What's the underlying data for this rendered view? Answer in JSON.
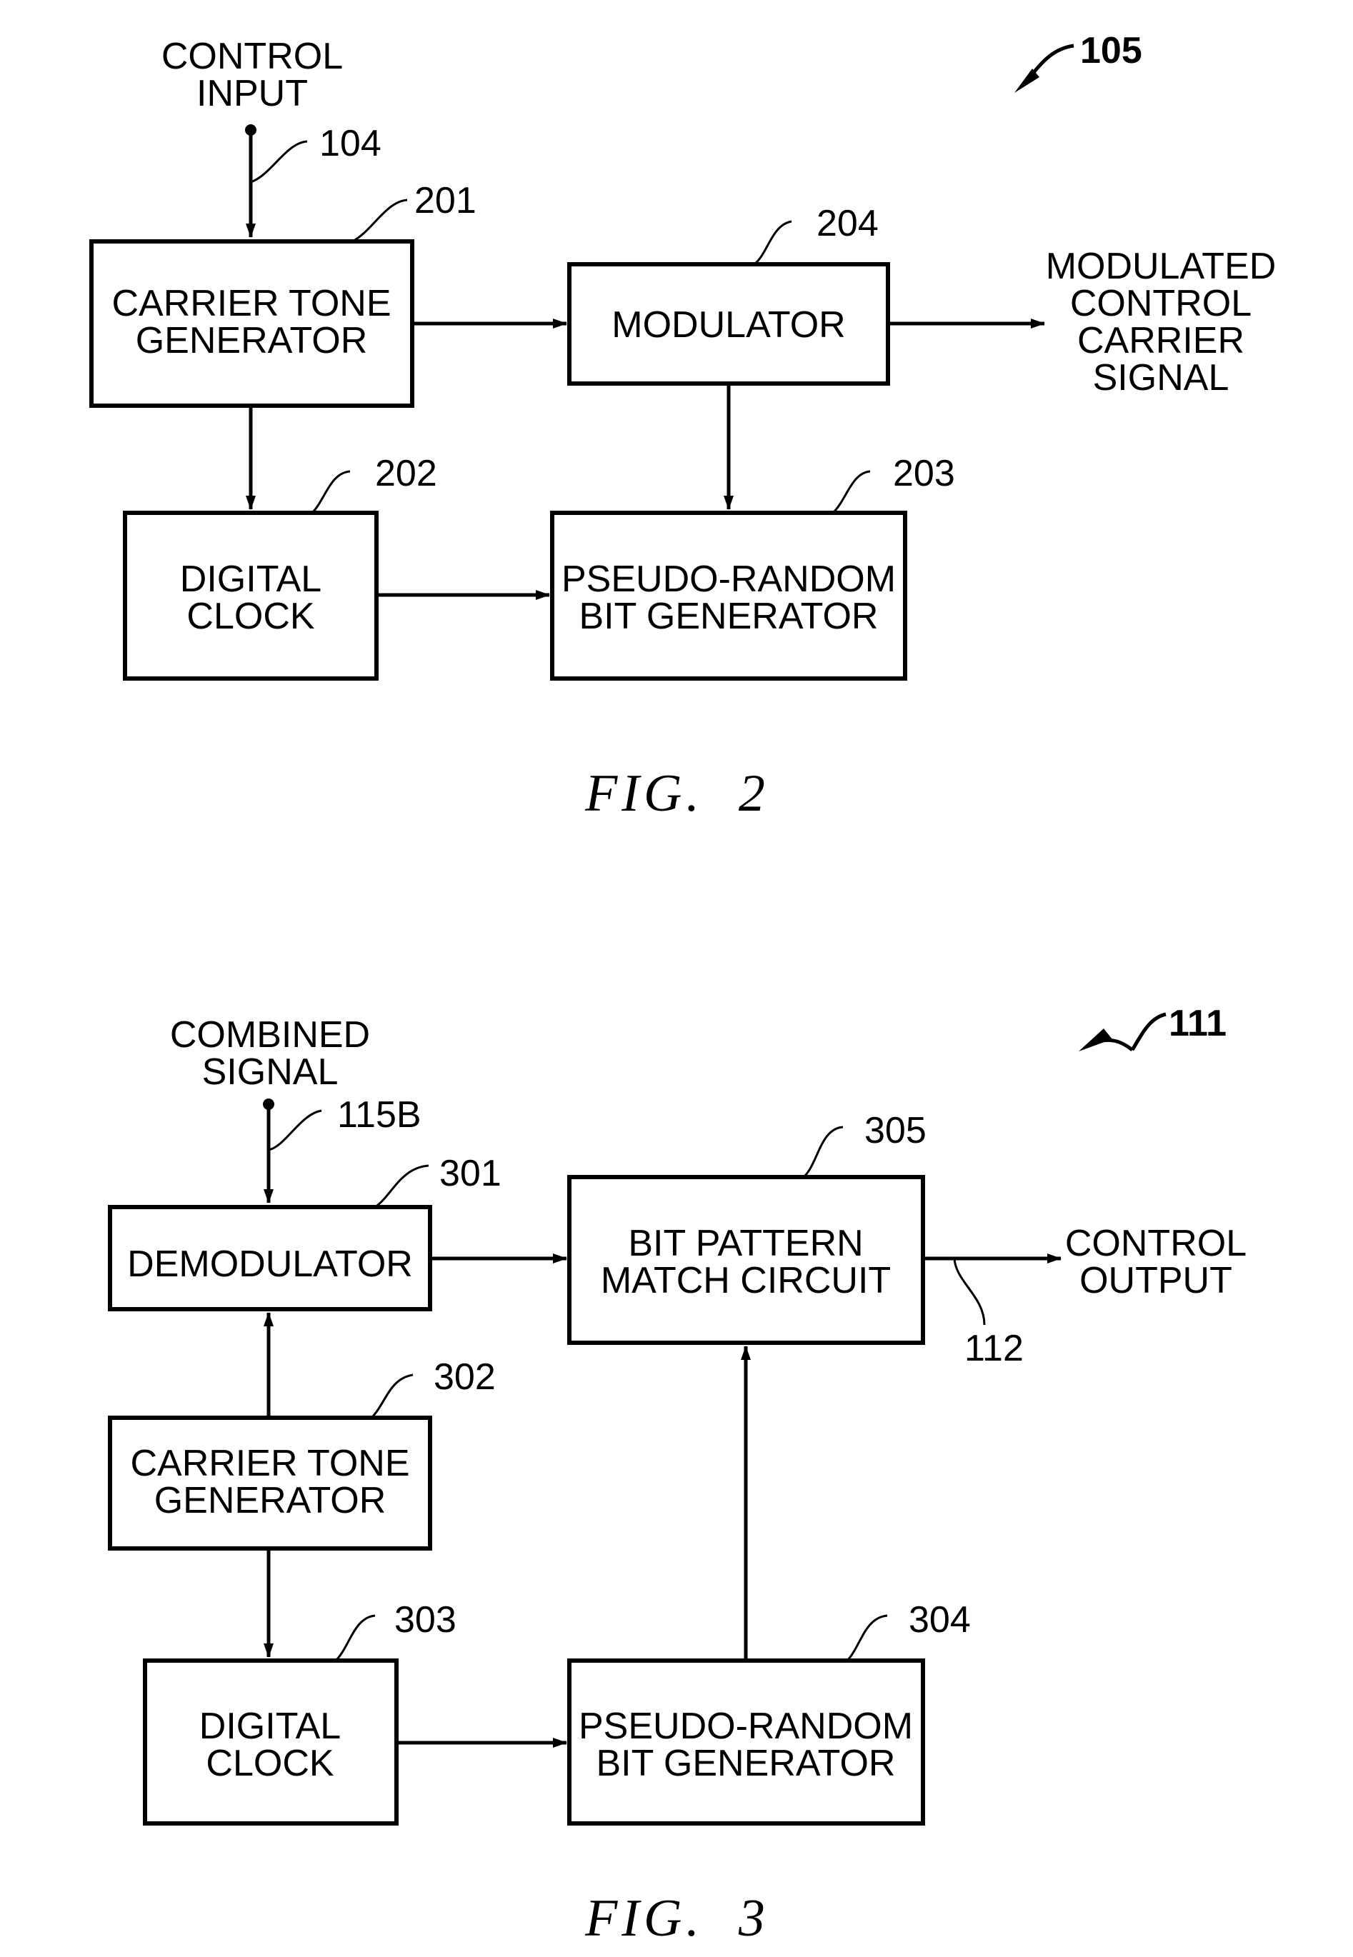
{
  "figures": [
    {
      "caption": "FIG.  2",
      "assembly_ref": "105",
      "input": {
        "label_lines": [
          "CONTROL",
          "INPUT"
        ],
        "ref": "104"
      },
      "output": {
        "label_lines": [
          "MODULATED",
          "CONTROL",
          "CARRIER",
          "SIGNAL"
        ]
      },
      "blocks": [
        {
          "id": "carrier-tone-generator",
          "ref": "201",
          "lines": [
            "CARRIER TONE",
            "GENERATOR"
          ]
        },
        {
          "id": "digital-clock",
          "ref": "202",
          "lines": [
            "DIGITAL",
            "CLOCK"
          ]
        },
        {
          "id": "pseudo-random-bit-generator",
          "ref": "203",
          "lines": [
            "PSEUDO-RANDOM",
            "BIT GENERATOR"
          ]
        },
        {
          "id": "modulator",
          "ref": "204",
          "lines": [
            "MODULATOR"
          ]
        }
      ],
      "connections": [
        [
          "control-input",
          "carrier-tone-generator"
        ],
        [
          "carrier-tone-generator",
          "modulator"
        ],
        [
          "carrier-tone-generator",
          "digital-clock"
        ],
        [
          "digital-clock",
          "pseudo-random-bit-generator"
        ],
        [
          "modulator",
          "pseudo-random-bit-generator"
        ],
        [
          "modulator",
          "modulated-control-carrier-signal"
        ]
      ]
    },
    {
      "caption": "FIG.  3",
      "assembly_ref": "111",
      "input": {
        "label_lines": [
          "COMBINED",
          "SIGNAL"
        ],
        "ref": "115B"
      },
      "output": {
        "label_lines": [
          "CONTROL",
          "OUTPUT"
        ],
        "ref": "112"
      },
      "blocks": [
        {
          "id": "demodulator",
          "ref": "301",
          "lines": [
            "DEMODULATOR"
          ]
        },
        {
          "id": "carrier-tone-generator",
          "ref": "302",
          "lines": [
            "CARRIER TONE",
            "GENERATOR"
          ]
        },
        {
          "id": "digital-clock",
          "ref": "303",
          "lines": [
            "DIGITAL",
            "CLOCK"
          ]
        },
        {
          "id": "pseudo-random-bit-generator",
          "ref": "304",
          "lines": [
            "PSEUDO-RANDOM",
            "BIT GENERATOR"
          ]
        },
        {
          "id": "bit-pattern-match-circuit",
          "ref": "305",
          "lines": [
            "BIT PATTERN",
            "MATCH CIRCUIT"
          ]
        }
      ],
      "connections": [
        [
          "combined-signal",
          "demodulator"
        ],
        [
          "carrier-tone-generator",
          "demodulator"
        ],
        [
          "carrier-tone-generator",
          "digital-clock"
        ],
        [
          "digital-clock",
          "pseudo-random-bit-generator"
        ],
        [
          "pseudo-random-bit-generator",
          "bit-pattern-match-circuit"
        ],
        [
          "demodulator",
          "bit-pattern-match-circuit"
        ],
        [
          "bit-pattern-match-circuit",
          "control-output"
        ]
      ]
    }
  ]
}
